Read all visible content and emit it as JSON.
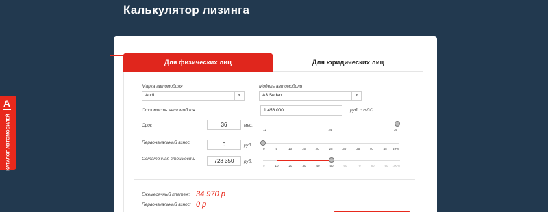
{
  "page": {
    "title": "Калькулятор лизинга"
  },
  "side_tab": {
    "logo": "А",
    "label": "КАТАЛОГ АВТОМОБИЛЕЙ"
  },
  "tabs": [
    {
      "label": "Для физических лиц",
      "active": true
    },
    {
      "label": "Для юридических лиц",
      "active": false
    }
  ],
  "form": {
    "brand": {
      "label": "Марка автомобиля",
      "value": "Audi"
    },
    "model": {
      "label": "Модель автомобиля",
      "value": "A3 Sedan"
    },
    "price": {
      "label": "Стоимость автомобиля",
      "value": "1 456 000",
      "unit": "руб. с НДС"
    },
    "term": {
      "label": "Срок",
      "value": "36",
      "unit": "мес.",
      "ticks": [
        "12",
        "24",
        "36"
      ],
      "min": 12,
      "max": 36,
      "current": 36
    },
    "down_payment": {
      "label": "Первоначальный взнос",
      "value": "0",
      "unit": "руб.",
      "ticks": [
        "0",
        "5",
        "10",
        "15",
        "20",
        "25",
        "30",
        "35",
        "40",
        "45",
        "49%"
      ],
      "min": 0,
      "max": 49,
      "current": 0
    },
    "residual": {
      "label": "Остаточная стоимость",
      "value": "728 350",
      "unit": "руб.",
      "ticks": [
        "0",
        "10",
        "20",
        "30",
        "40",
        "50",
        "60",
        "70",
        "80",
        "90",
        "100%"
      ],
      "min": 0,
      "max": 100,
      "current": 50,
      "enabled_min": 10,
      "enabled_max": 50
    }
  },
  "results": {
    "monthly": {
      "label": "Ежемесячный платеж:",
      "value": "34 970 р"
    },
    "initial": {
      "label": "Первоначальный взнос:",
      "value": "0 р"
    }
  },
  "colors": {
    "accent": "#e8291c",
    "background": "#22394f"
  }
}
